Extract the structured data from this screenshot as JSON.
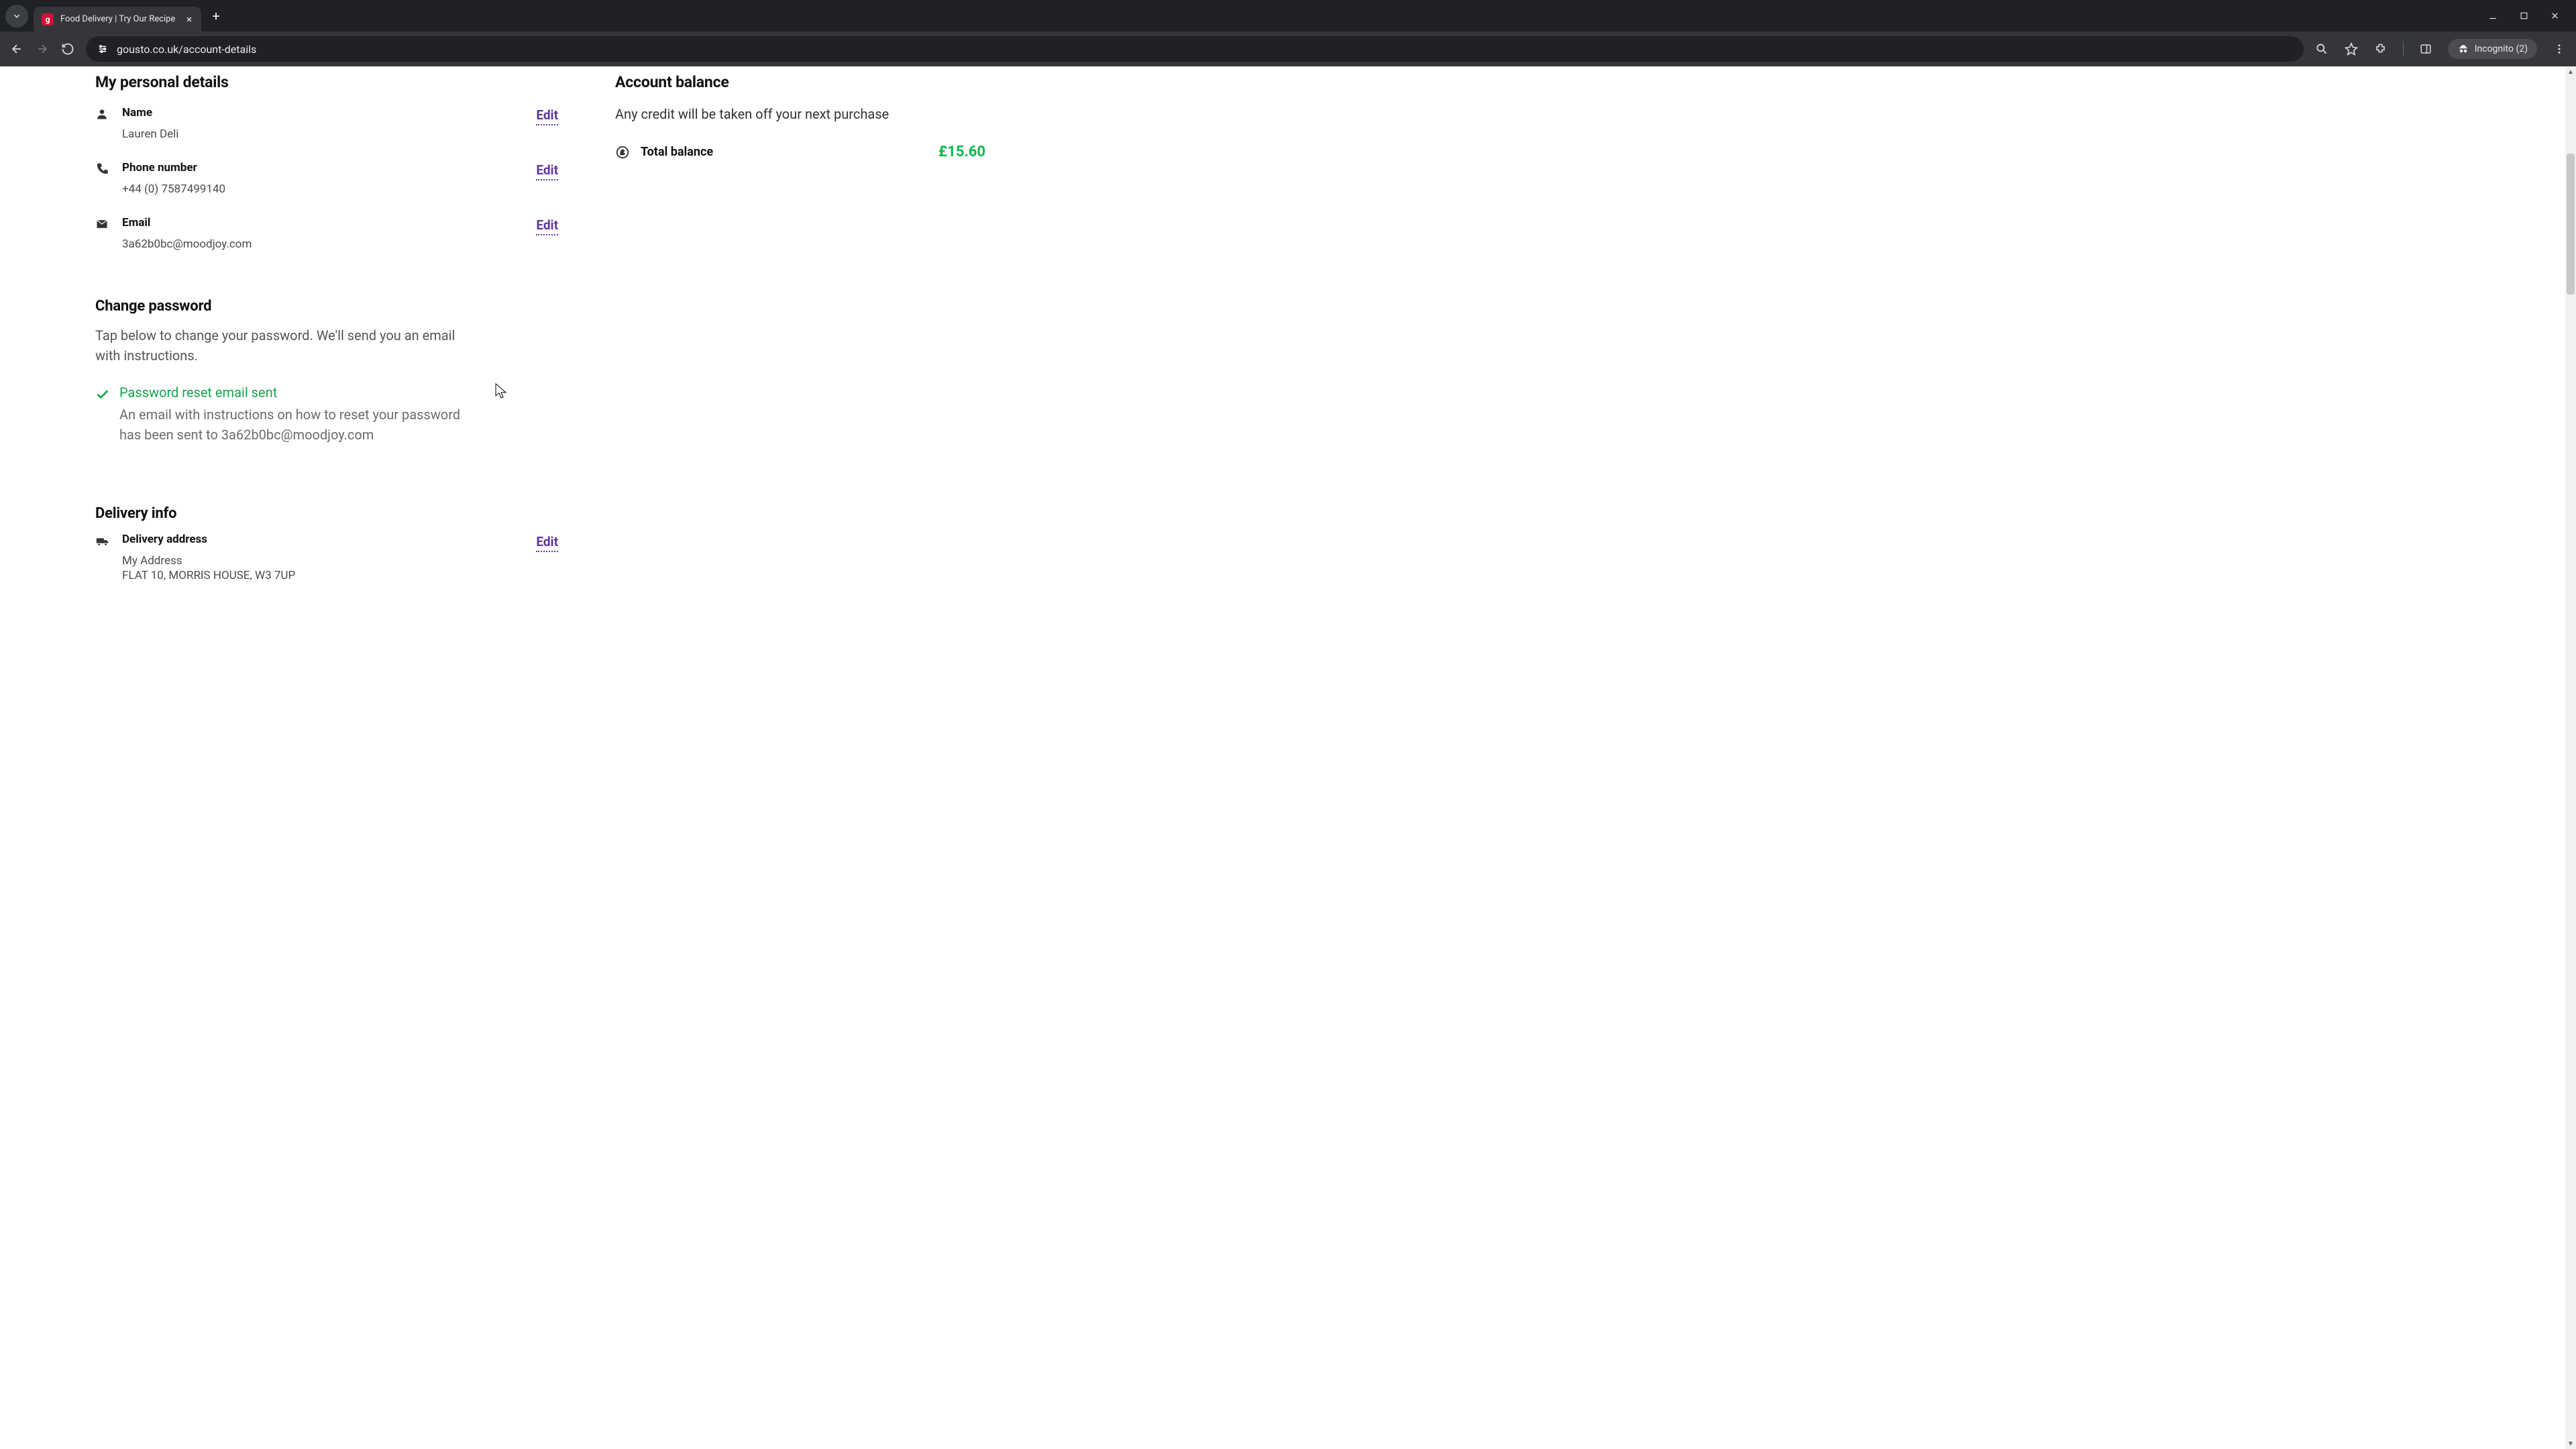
{
  "browser": {
    "tab_title": "Food Delivery | Try Our Recipe",
    "url": "gousto.co.uk/account-details",
    "incognito_label": "Incognito (2)"
  },
  "personal_details": {
    "heading": "My personal details",
    "name_label": "Name",
    "name_value": "Lauren Deli",
    "phone_label": "Phone number",
    "phone_value": "+44 (0) 7587499140",
    "email_label": "Email",
    "email_value": "3a62b0bc@moodjoy.com",
    "edit_label": "Edit"
  },
  "change_password": {
    "heading": "Change password",
    "description": "Tap below to change your password. We'll send you an email with instructions.",
    "notice_title": "Password reset email sent",
    "notice_body": "An email with instructions on how to reset your password has been sent to 3a62b0bc@moodjoy.com"
  },
  "delivery": {
    "heading": "Delivery info",
    "address_label": "Delivery address",
    "address_name": "My Address",
    "address_line": "FLAT 10, MORRIS HOUSE, W3 7UP",
    "edit_label": "Edit"
  },
  "balance": {
    "heading": "Account balance",
    "description": "Any credit will be taken off your next purchase",
    "total_label": "Total balance",
    "total_value": "£15.60"
  }
}
